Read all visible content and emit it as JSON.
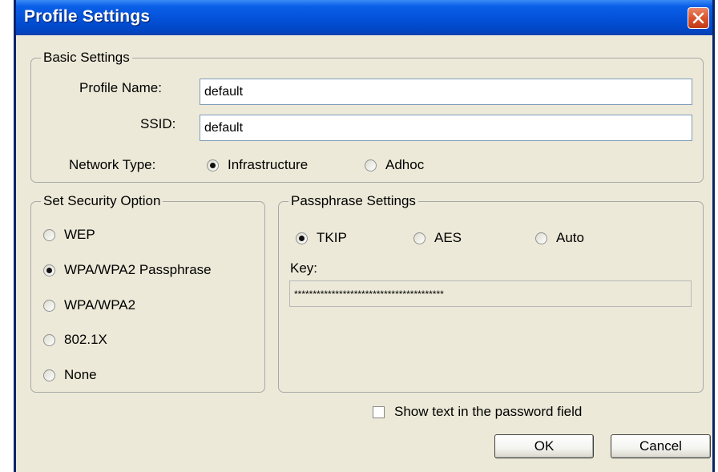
{
  "window": {
    "title": "Profile Settings"
  },
  "basic_settings": {
    "legend": "Basic Settings",
    "profile_name_label": "Profile Name:",
    "profile_name_value": "default",
    "ssid_label": "SSID:",
    "ssid_value": "default",
    "network_type_label": "Network Type:",
    "network_types": [
      {
        "label": "Infrastructure",
        "selected": true
      },
      {
        "label": "Adhoc",
        "selected": false
      }
    ]
  },
  "security": {
    "legend": "Set Security Option",
    "options": [
      {
        "label": "WEP",
        "selected": false
      },
      {
        "label": "WPA/WPA2 Passphrase",
        "selected": true
      },
      {
        "label": "WPA/WPA2",
        "selected": false
      },
      {
        "label": "802.1X",
        "selected": false
      },
      {
        "label": "None",
        "selected": false
      }
    ]
  },
  "passphrase": {
    "legend": "Passphrase Settings",
    "ciphers": [
      {
        "label": "TKIP",
        "selected": true
      },
      {
        "label": "AES",
        "selected": false
      },
      {
        "label": "Auto",
        "selected": false
      }
    ],
    "key_label": "Key:",
    "key_value": "****************************************"
  },
  "show_text_label": "Show text in the password field",
  "show_text_checked": false,
  "buttons": {
    "ok": "OK",
    "cancel": "Cancel"
  }
}
